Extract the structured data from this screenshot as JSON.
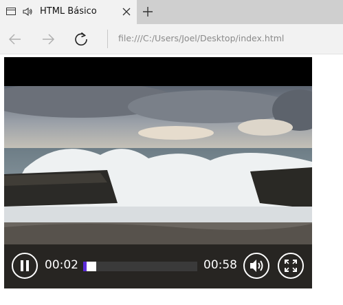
{
  "browser": {
    "tab": {
      "title": "HTML Básico",
      "icons": [
        "window-icon",
        "speaker-icon",
        "close-icon"
      ]
    },
    "new_tab_icon": "plus-icon",
    "nav": {
      "icons": [
        "back-arrow-icon",
        "forward-arrow-icon",
        "refresh-icon"
      ],
      "url": "file:///C:/Users/Joel/Desktop/index.html"
    }
  },
  "video": {
    "current_time": "00:02",
    "duration": "00:58",
    "progress": 0.034,
    "state": "playing",
    "accent_color": "#5b2bd8",
    "control_icons": [
      "pause-icon",
      "volume-icon",
      "fullscreen-icon"
    ]
  }
}
